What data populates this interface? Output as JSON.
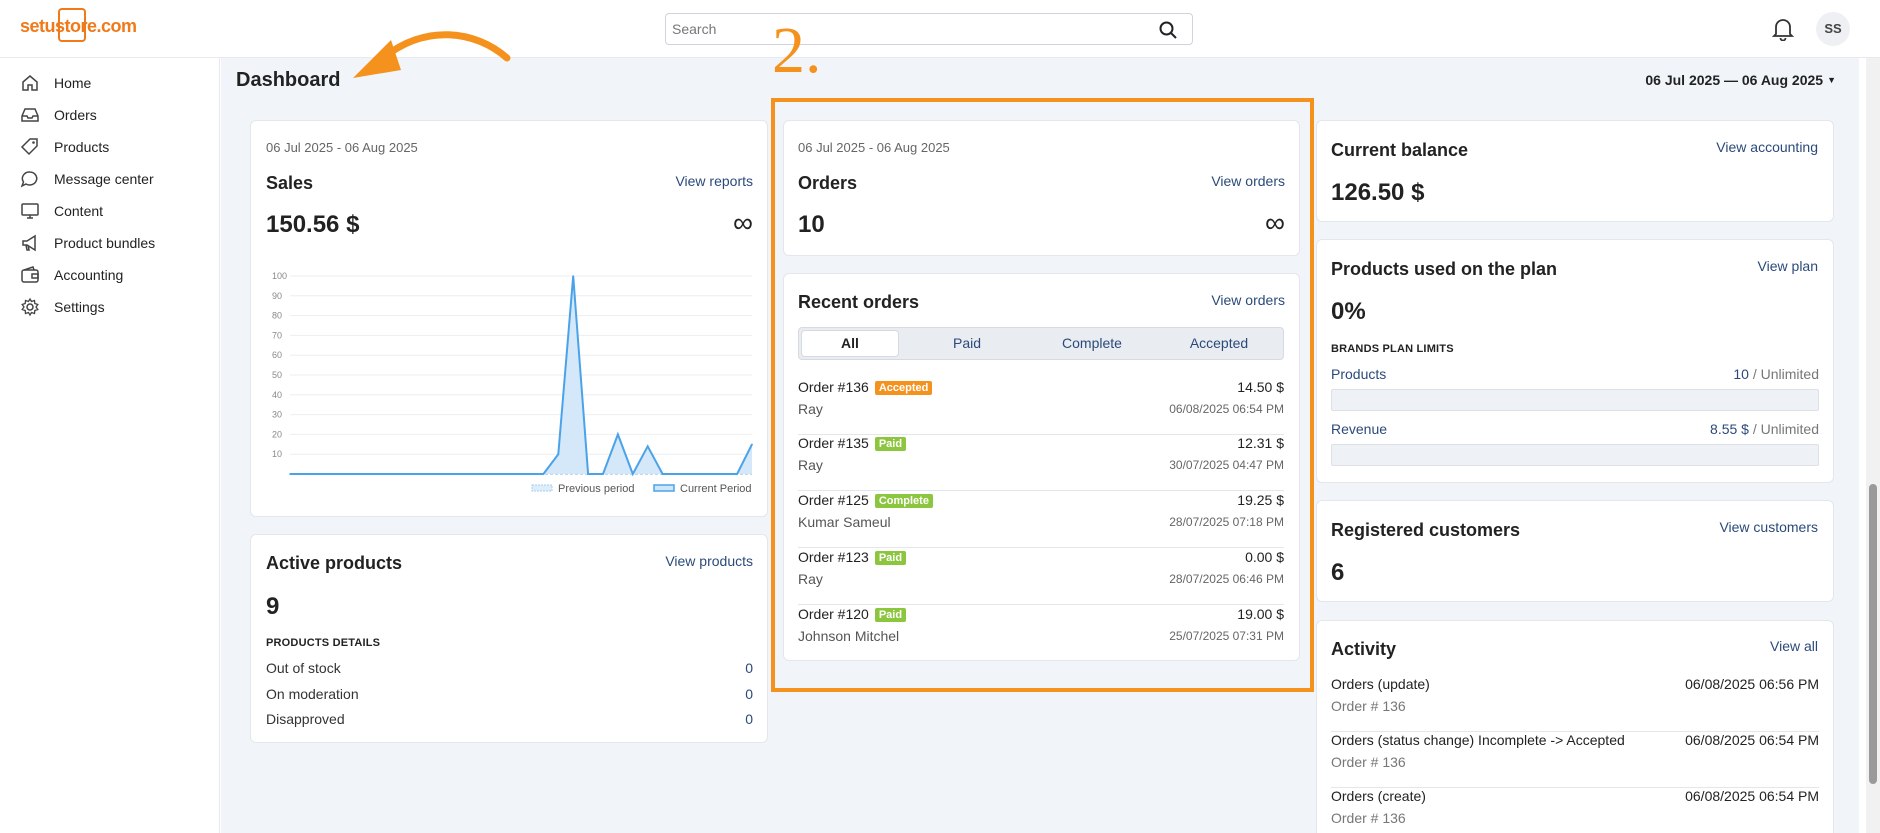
{
  "header": {
    "logo": "setustore.com",
    "search_placeholder": "Search",
    "avatar_initials": "SS"
  },
  "sidebar": {
    "items": [
      {
        "label": "Home",
        "icon": "home-icon"
      },
      {
        "label": "Orders",
        "icon": "inbox-icon"
      },
      {
        "label": "Products",
        "icon": "tag-icon"
      },
      {
        "label": "Message center",
        "icon": "chat-icon"
      },
      {
        "label": "Content",
        "icon": "monitor-icon"
      },
      {
        "label": "Product bundles",
        "icon": "megaphone-icon"
      },
      {
        "label": "Accounting",
        "icon": "wallet-icon"
      },
      {
        "label": "Settings",
        "icon": "gear-icon"
      }
    ]
  },
  "page": {
    "title": "Dashboard",
    "date_range": "06 Jul 2025 — 06 Aug 2025"
  },
  "annotation": {
    "step": "2.",
    "color": "#f5921e"
  },
  "sales": {
    "date": "06 Jul 2025 - 06 Aug 2025",
    "title": "Sales",
    "link": "View reports",
    "value": "150.56 $",
    "infinity": "∞"
  },
  "chart_data": {
    "type": "area",
    "yticks": [
      "10",
      "20",
      "30",
      "40",
      "50",
      "60",
      "70",
      "80",
      "90",
      "100"
    ],
    "ylim": [
      0,
      100
    ],
    "series": [
      {
        "name": "Previous period",
        "values": [
          0,
          0,
          0,
          0,
          0,
          0,
          0,
          0,
          0,
          0,
          0,
          0,
          0,
          0,
          0,
          0,
          0,
          0,
          0,
          0,
          0,
          0,
          0,
          0,
          0,
          0,
          0,
          0,
          0,
          0,
          0,
          0
        ]
      },
      {
        "name": "Current Period",
        "values": [
          0,
          0,
          0,
          0,
          0,
          0,
          0,
          0,
          0,
          0,
          0,
          0,
          0,
          0,
          0,
          0,
          0,
          0,
          10,
          100,
          0,
          0,
          20,
          0,
          14,
          0,
          0,
          0,
          0,
          0,
          0,
          15
        ]
      }
    ],
    "legend": "bottom-right",
    "colors": {
      "current": "#4aa3e8",
      "fill": "#cfe6f8",
      "previous": "#a9cbe9"
    }
  },
  "orders_card": {
    "date": "06 Jul 2025 - 06 Aug 2025",
    "title": "Orders",
    "link": "View orders",
    "value": "10",
    "infinity": "∞"
  },
  "recent_orders": {
    "title": "Recent orders",
    "link": "View orders",
    "tabs": [
      "All",
      "Paid",
      "Complete",
      "Accepted"
    ],
    "orders": [
      {
        "number": "Order #136",
        "status": "Accepted",
        "color": "#f5921e",
        "customer": "Ray",
        "amount": "14.50 $",
        "date": "06/08/2025 06:54 PM"
      },
      {
        "number": "Order #135",
        "status": "Paid",
        "color": "#8cc63f",
        "customer": "Ray",
        "amount": "12.31 $",
        "date": "30/07/2025 04:47 PM"
      },
      {
        "number": "Order #125",
        "status": "Complete",
        "color": "#8cc63f",
        "customer": "Kumar Sameul",
        "amount": "19.25 $",
        "date": "28/07/2025 07:18 PM"
      },
      {
        "number": "Order #123",
        "status": "Paid",
        "color": "#8cc63f",
        "customer": "Ray",
        "amount": "0.00 $",
        "date": "28/07/2025 06:46 PM"
      },
      {
        "number": "Order #120",
        "status": "Paid",
        "color": "#8cc63f",
        "customer": "Johnson Mitchel",
        "amount": "19.00 $",
        "date": "25/07/2025 07:31 PM"
      }
    ]
  },
  "active_products": {
    "title": "Active products",
    "link": "View products",
    "value": "9",
    "details_label": "PRODUCTS DETAILS",
    "rows": [
      {
        "label": "Out of stock",
        "value": "0"
      },
      {
        "label": "On moderation",
        "value": "0"
      },
      {
        "label": "Disapproved",
        "value": "0"
      }
    ]
  },
  "balance": {
    "title": "Current balance",
    "link": "View accounting",
    "value": "126.50 $"
  },
  "plan": {
    "title": "Products used on the plan",
    "link": "View plan",
    "value": "0%",
    "limits_label": "BRANDS PLAN LIMITS",
    "products_label": "Products",
    "products_used": "10",
    "products_limit": "/ Unlimited",
    "revenue_label": "Revenue",
    "revenue_used": "8.55 $",
    "revenue_limit": "/ Unlimited"
  },
  "customers": {
    "title": "Registered customers",
    "link": "View customers",
    "value": "6"
  },
  "activity": {
    "title": "Activity",
    "link": "View all",
    "items": [
      {
        "title": "Orders (update)",
        "sub": "Order # 136",
        "date": "06/08/2025 06:56 PM"
      },
      {
        "title": "Orders (status change) Incomplete -> Accepted",
        "sub": "Order # 136",
        "date": "06/08/2025 06:54 PM"
      },
      {
        "title": "Orders (create)",
        "sub": "Order # 136",
        "date": "06/08/2025 06:54 PM"
      }
    ]
  }
}
